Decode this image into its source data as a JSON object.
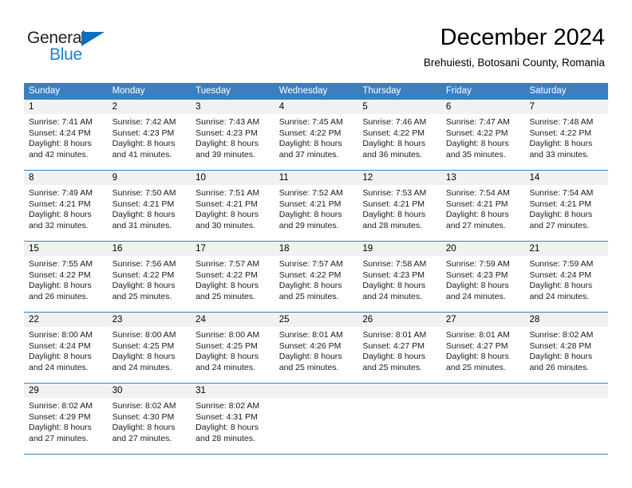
{
  "brand": {
    "name_part1": "General",
    "name_part2": "Blue",
    "color_dark": "#231f20",
    "color_blue": "#1b7fd4",
    "triangle_color": "#0d6fb8"
  },
  "header": {
    "title": "December 2024",
    "subtitle": "Brehuiesti, Botosani County, Romania"
  },
  "theme": {
    "header_band": "#3a80c1",
    "day_band": "#f1f1f1",
    "text": "#000000"
  },
  "weekdays": [
    "Sunday",
    "Monday",
    "Tuesday",
    "Wednesday",
    "Thursday",
    "Friday",
    "Saturday"
  ],
  "weeks": [
    [
      {
        "day": "1",
        "sunrise": "Sunrise: 7:41 AM",
        "sunset": "Sunset: 4:24 PM",
        "daylight1": "Daylight: 8 hours",
        "daylight2": "and 42 minutes."
      },
      {
        "day": "2",
        "sunrise": "Sunrise: 7:42 AM",
        "sunset": "Sunset: 4:23 PM",
        "daylight1": "Daylight: 8 hours",
        "daylight2": "and 41 minutes."
      },
      {
        "day": "3",
        "sunrise": "Sunrise: 7:43 AM",
        "sunset": "Sunset: 4:23 PM",
        "daylight1": "Daylight: 8 hours",
        "daylight2": "and 39 minutes."
      },
      {
        "day": "4",
        "sunrise": "Sunrise: 7:45 AM",
        "sunset": "Sunset: 4:22 PM",
        "daylight1": "Daylight: 8 hours",
        "daylight2": "and 37 minutes."
      },
      {
        "day": "5",
        "sunrise": "Sunrise: 7:46 AM",
        "sunset": "Sunset: 4:22 PM",
        "daylight1": "Daylight: 8 hours",
        "daylight2": "and 36 minutes."
      },
      {
        "day": "6",
        "sunrise": "Sunrise: 7:47 AM",
        "sunset": "Sunset: 4:22 PM",
        "daylight1": "Daylight: 8 hours",
        "daylight2": "and 35 minutes."
      },
      {
        "day": "7",
        "sunrise": "Sunrise: 7:48 AM",
        "sunset": "Sunset: 4:22 PM",
        "daylight1": "Daylight: 8 hours",
        "daylight2": "and 33 minutes."
      }
    ],
    [
      {
        "day": "8",
        "sunrise": "Sunrise: 7:49 AM",
        "sunset": "Sunset: 4:21 PM",
        "daylight1": "Daylight: 8 hours",
        "daylight2": "and 32 minutes."
      },
      {
        "day": "9",
        "sunrise": "Sunrise: 7:50 AM",
        "sunset": "Sunset: 4:21 PM",
        "daylight1": "Daylight: 8 hours",
        "daylight2": "and 31 minutes."
      },
      {
        "day": "10",
        "sunrise": "Sunrise: 7:51 AM",
        "sunset": "Sunset: 4:21 PM",
        "daylight1": "Daylight: 8 hours",
        "daylight2": "and 30 minutes."
      },
      {
        "day": "11",
        "sunrise": "Sunrise: 7:52 AM",
        "sunset": "Sunset: 4:21 PM",
        "daylight1": "Daylight: 8 hours",
        "daylight2": "and 29 minutes."
      },
      {
        "day": "12",
        "sunrise": "Sunrise: 7:53 AM",
        "sunset": "Sunset: 4:21 PM",
        "daylight1": "Daylight: 8 hours",
        "daylight2": "and 28 minutes."
      },
      {
        "day": "13",
        "sunrise": "Sunrise: 7:54 AM",
        "sunset": "Sunset: 4:21 PM",
        "daylight1": "Daylight: 8 hours",
        "daylight2": "and 27 minutes."
      },
      {
        "day": "14",
        "sunrise": "Sunrise: 7:54 AM",
        "sunset": "Sunset: 4:21 PM",
        "daylight1": "Daylight: 8 hours",
        "daylight2": "and 27 minutes."
      }
    ],
    [
      {
        "day": "15",
        "sunrise": "Sunrise: 7:55 AM",
        "sunset": "Sunset: 4:22 PM",
        "daylight1": "Daylight: 8 hours",
        "daylight2": "and 26 minutes."
      },
      {
        "day": "16",
        "sunrise": "Sunrise: 7:56 AM",
        "sunset": "Sunset: 4:22 PM",
        "daylight1": "Daylight: 8 hours",
        "daylight2": "and 25 minutes."
      },
      {
        "day": "17",
        "sunrise": "Sunrise: 7:57 AM",
        "sunset": "Sunset: 4:22 PM",
        "daylight1": "Daylight: 8 hours",
        "daylight2": "and 25 minutes."
      },
      {
        "day": "18",
        "sunrise": "Sunrise: 7:57 AM",
        "sunset": "Sunset: 4:22 PM",
        "daylight1": "Daylight: 8 hours",
        "daylight2": "and 25 minutes."
      },
      {
        "day": "19",
        "sunrise": "Sunrise: 7:58 AM",
        "sunset": "Sunset: 4:23 PM",
        "daylight1": "Daylight: 8 hours",
        "daylight2": "and 24 minutes."
      },
      {
        "day": "20",
        "sunrise": "Sunrise: 7:59 AM",
        "sunset": "Sunset: 4:23 PM",
        "daylight1": "Daylight: 8 hours",
        "daylight2": "and 24 minutes."
      },
      {
        "day": "21",
        "sunrise": "Sunrise: 7:59 AM",
        "sunset": "Sunset: 4:24 PM",
        "daylight1": "Daylight: 8 hours",
        "daylight2": "and 24 minutes."
      }
    ],
    [
      {
        "day": "22",
        "sunrise": "Sunrise: 8:00 AM",
        "sunset": "Sunset: 4:24 PM",
        "daylight1": "Daylight: 8 hours",
        "daylight2": "and 24 minutes."
      },
      {
        "day": "23",
        "sunrise": "Sunrise: 8:00 AM",
        "sunset": "Sunset: 4:25 PM",
        "daylight1": "Daylight: 8 hours",
        "daylight2": "and 24 minutes."
      },
      {
        "day": "24",
        "sunrise": "Sunrise: 8:00 AM",
        "sunset": "Sunset: 4:25 PM",
        "daylight1": "Daylight: 8 hours",
        "daylight2": "and 24 minutes."
      },
      {
        "day": "25",
        "sunrise": "Sunrise: 8:01 AM",
        "sunset": "Sunset: 4:26 PM",
        "daylight1": "Daylight: 8 hours",
        "daylight2": "and 25 minutes."
      },
      {
        "day": "26",
        "sunrise": "Sunrise: 8:01 AM",
        "sunset": "Sunset: 4:27 PM",
        "daylight1": "Daylight: 8 hours",
        "daylight2": "and 25 minutes."
      },
      {
        "day": "27",
        "sunrise": "Sunrise: 8:01 AM",
        "sunset": "Sunset: 4:27 PM",
        "daylight1": "Daylight: 8 hours",
        "daylight2": "and 25 minutes."
      },
      {
        "day": "28",
        "sunrise": "Sunrise: 8:02 AM",
        "sunset": "Sunset: 4:28 PM",
        "daylight1": "Daylight: 8 hours",
        "daylight2": "and 26 minutes."
      }
    ],
    [
      {
        "day": "29",
        "sunrise": "Sunrise: 8:02 AM",
        "sunset": "Sunset: 4:29 PM",
        "daylight1": "Daylight: 8 hours",
        "daylight2": "and 27 minutes."
      },
      {
        "day": "30",
        "sunrise": "Sunrise: 8:02 AM",
        "sunset": "Sunset: 4:30 PM",
        "daylight1": "Daylight: 8 hours",
        "daylight2": "and 27 minutes."
      },
      {
        "day": "31",
        "sunrise": "Sunrise: 8:02 AM",
        "sunset": "Sunset: 4:31 PM",
        "daylight1": "Daylight: 8 hours",
        "daylight2": "and 28 minutes."
      },
      {
        "day": "",
        "sunrise": "",
        "sunset": "",
        "daylight1": "",
        "daylight2": ""
      },
      {
        "day": "",
        "sunrise": "",
        "sunset": "",
        "daylight1": "",
        "daylight2": ""
      },
      {
        "day": "",
        "sunrise": "",
        "sunset": "",
        "daylight1": "",
        "daylight2": ""
      },
      {
        "day": "",
        "sunrise": "",
        "sunset": "",
        "daylight1": "",
        "daylight2": ""
      }
    ]
  ]
}
